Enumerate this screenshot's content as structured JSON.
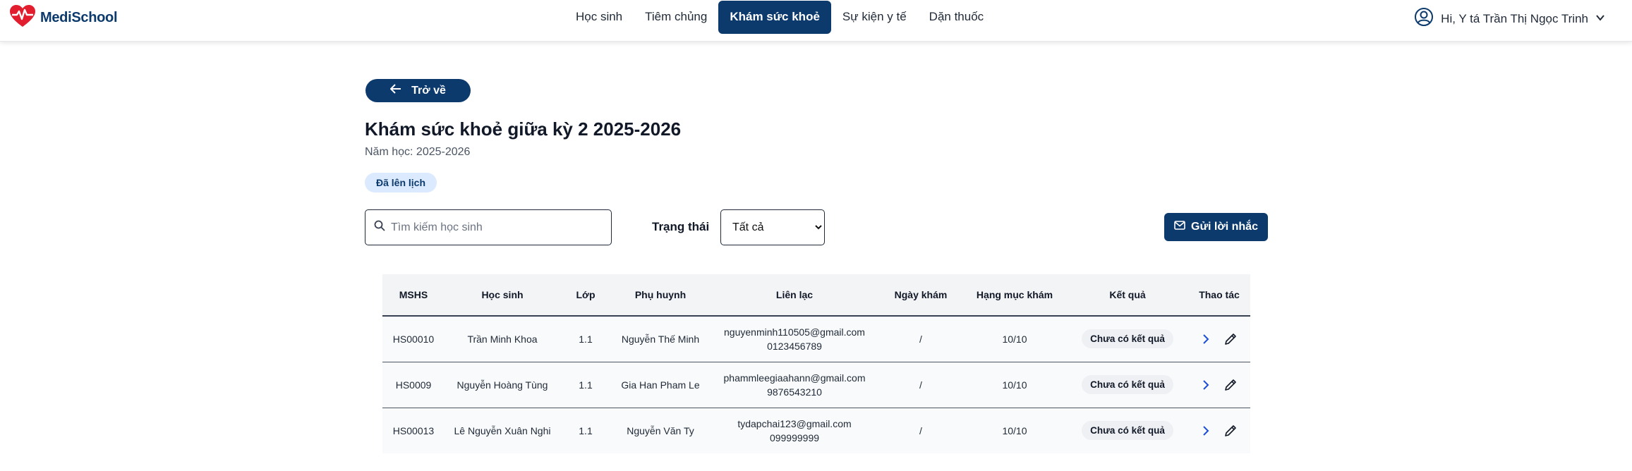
{
  "brand": {
    "name": "MediSchool"
  },
  "nav": {
    "items": [
      {
        "label": "Học sinh",
        "active": false
      },
      {
        "label": "Tiêm chủng",
        "active": false
      },
      {
        "label": "Khám sức khoẻ",
        "active": true
      },
      {
        "label": "Sự kiện y tế",
        "active": false
      },
      {
        "label": "Dặn thuốc",
        "active": false
      }
    ]
  },
  "user": {
    "greeting": "Hi, Y tá Trần Thị Ngọc Trinh"
  },
  "page": {
    "back_label": "Trở về",
    "title": "Khám sức khoẻ giữa kỳ 2 2025-2026",
    "subtitle": "Năm học: 2025-2026",
    "status": "Đã lên lịch"
  },
  "filters": {
    "search_placeholder": "Tìm kiếm học sinh",
    "status_label": "Trạng thái",
    "status_selected": "Tất cả",
    "remind_label": "Gửi lời nhắc"
  },
  "table": {
    "headers": {
      "id": "MSHS",
      "student": "Học sinh",
      "class": "Lớp",
      "parent": "Phụ huynh",
      "contact": "Liên lạc",
      "date": "Ngày khám",
      "items": "Hạng mục khám",
      "result": "Kết quả",
      "actions": "Thao tác"
    },
    "rows": [
      {
        "id": "HS00010",
        "student": "Trần Minh Khoa",
        "class": "1.1",
        "parent": "Nguyễn Thế Minh",
        "email": "nguyenminh110505@gmail.com",
        "phone": "0123456789",
        "date": "/",
        "items": "10/10",
        "result": "Chưa có kết quả"
      },
      {
        "id": "HS0009",
        "student": "Nguyễn Hoàng Tùng",
        "class": "1.1",
        "parent": "Gia Han Pham Le",
        "email": "phammleegiaahann@gmail.com",
        "phone": "9876543210",
        "date": "/",
        "items": "10/10",
        "result": "Chưa có kết quả"
      },
      {
        "id": "HS00013",
        "student": "Lê Nguyễn Xuân Nghi",
        "class": "1.1",
        "parent": "Nguyễn Văn Ty",
        "email": "tydapchai123@gmail.com",
        "phone": "099999999",
        "date": "/",
        "items": "10/10",
        "result": "Chưa có kết quả"
      }
    ]
  },
  "colors": {
    "primary": "#0c3a6d",
    "logo_red": "#e11d2e",
    "pill_bg": "#dbeafe"
  },
  "icons": {
    "logo": "heart-pulse-icon",
    "user": "user-circle-icon",
    "back": "arrow-left-icon",
    "search": "search-icon",
    "mail": "mail-icon",
    "view": "chevron-right-icon",
    "edit": "pencil-icon"
  }
}
